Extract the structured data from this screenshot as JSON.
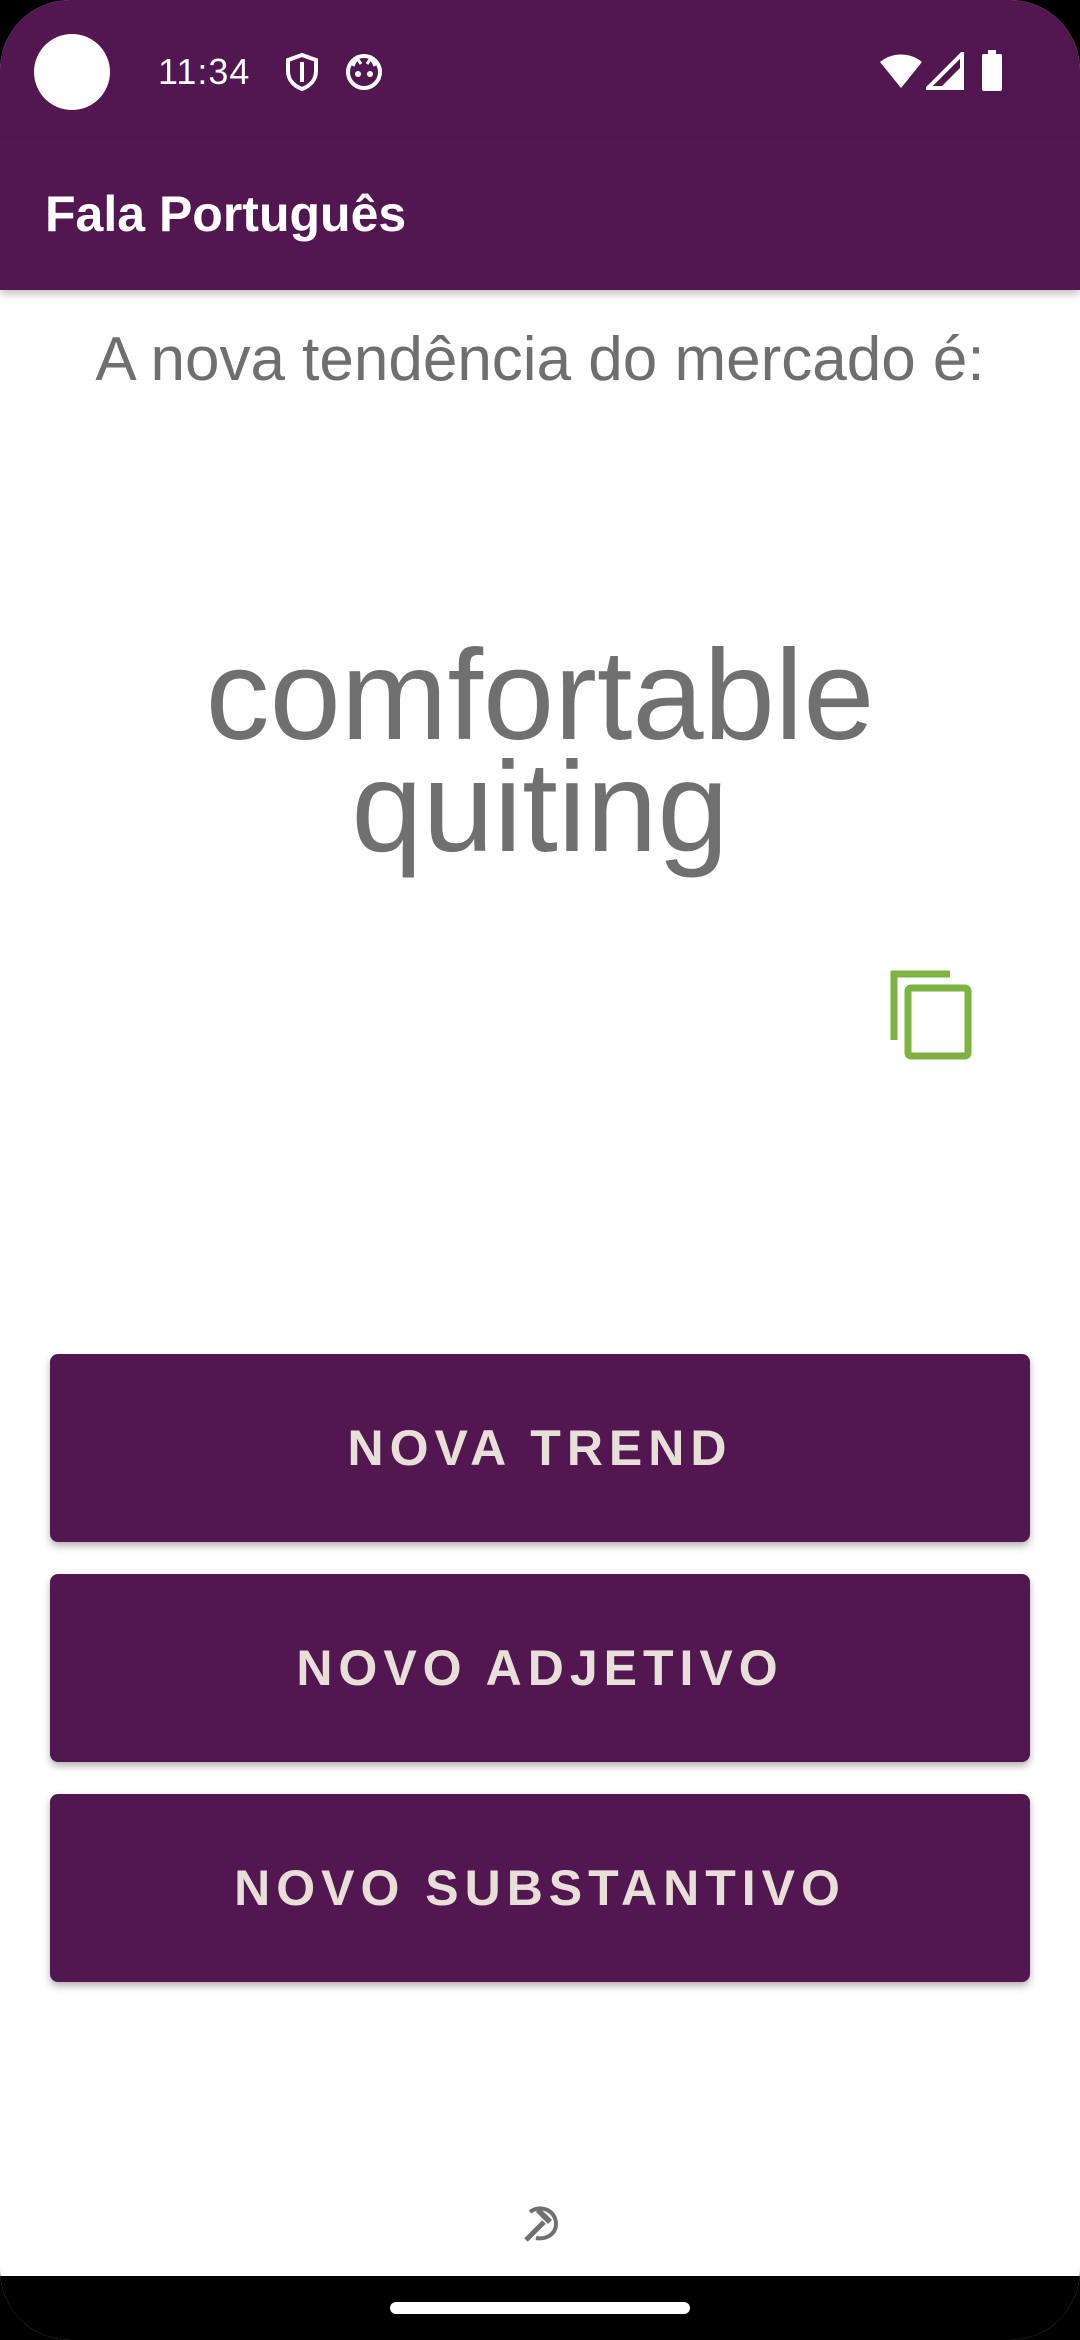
{
  "status_bar": {
    "time": "11:34",
    "left_icons": [
      "shield-icon",
      "cat-face-icon"
    ],
    "right_icons": [
      "wifi-icon",
      "signal-icon",
      "battery-icon"
    ],
    "background": "#521751"
  },
  "app_bar": {
    "title": "Fala Português",
    "background": "#521751"
  },
  "main": {
    "prompt": "A nova tendência do mercado é:",
    "result_line1": "comfortable",
    "result_line2": "quiting",
    "copy_icon": "copy-icon",
    "copy_icon_color": "#7cb342"
  },
  "buttons": {
    "new_trend": "NOVA TREND",
    "new_adjective": "NOVO ADJETIVO",
    "new_noun": "NOVO SUBSTANTIVO",
    "background": "#521751",
    "text_color": "#e8dfd8"
  },
  "footer": {
    "icon": "hammer-sickle-icon"
  }
}
